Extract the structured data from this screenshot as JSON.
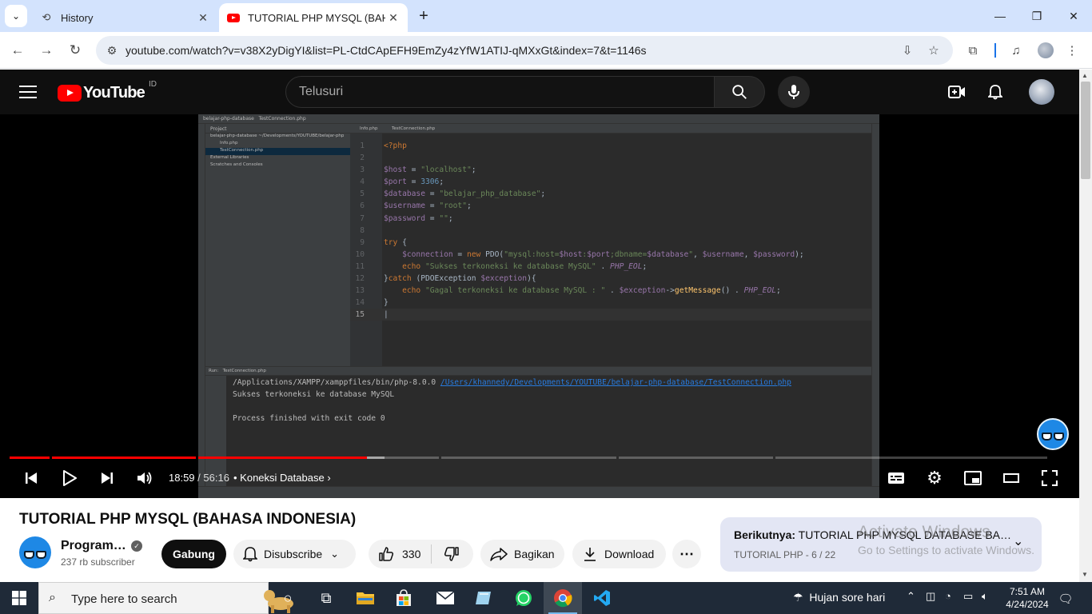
{
  "browser": {
    "tabs": [
      {
        "label": "History",
        "icon": "history-icon"
      },
      {
        "label": "TUTORIAL PHP MYSQL (BAHASA INDONESIA)",
        "icon": "youtube-favicon"
      }
    ],
    "url": "youtube.com/watch?v=v38X2yDigYI&list=PL-CtdCApEFH9EmZy4zYfW1ATIJ-qMXxGt&index=7&t=1146s"
  },
  "youtube": {
    "logo_text": "YouTube",
    "country_code": "ID",
    "search_placeholder": "Telusuri"
  },
  "ide": {
    "project_name": "belajar-php-database",
    "file_tab": "TestConnection.php",
    "project_label": "Project",
    "project_tree": [
      "belajar-php-database  ~/Developments/YOUTUBE/belajar-php",
      "Info.php",
      "TestConnection.php",
      "External Libraries",
      "Scratches and Consoles"
    ],
    "editor_tabs": [
      "Info.php",
      "TestConnection.php"
    ],
    "run_label": "Run:",
    "run_tab": "TestConnection.php",
    "run_output": {
      "cmd": "/Applications/XAMPP/xamppfiles/bin/php-8.0.0 ",
      "path": "/Users/khannedy/Developments/YOUTUBE/belajar-php-database/TestConnection.php",
      "line2": "Sukses terkoneksi ke database MySQL",
      "line4": "Process finished with exit code 0"
    }
  },
  "player": {
    "current_time": "18:59",
    "duration": "56:16",
    "chapter": "Koneksi Database",
    "progress_fraction": 0.337
  },
  "video": {
    "title": "TUTORIAL PHP MYSQL (BAHASA INDONESIA)",
    "channel": "Program…",
    "subscribers": "237 rb subscriber",
    "join_label": "Gabung",
    "subscribe_label": "Disubscribe",
    "likes": "330",
    "share_label": "Bagikan",
    "download_label": "Download"
  },
  "up_next": {
    "prefix": "Berikutnya:",
    "title": "TUTORIAL PHP MYSQL DATABASE BA…",
    "playlist": "TUTORIAL PHP - 6 / 22"
  },
  "watermark": {
    "line1": "Activate Windows",
    "line2": "Go to Settings to activate Windows."
  },
  "taskbar": {
    "search_placeholder": "Type here to search",
    "weather": "Hujan sore hari",
    "time": "7:51 AM",
    "date": "4/24/2024"
  },
  "colors": {
    "youtube_red": "#ff0000",
    "chrome_tabbar": "#d3e3fd",
    "taskbar": "#1f2a38",
    "ide_bg": "#2b2b2b"
  }
}
